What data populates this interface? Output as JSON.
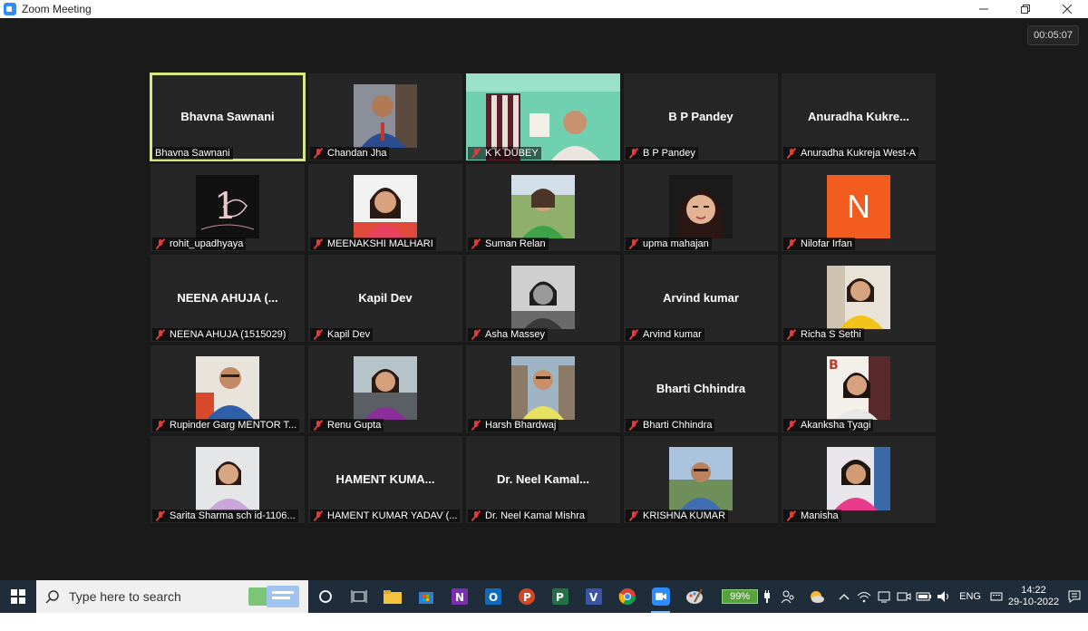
{
  "window": {
    "title": "Zoom Meeting"
  },
  "meeting": {
    "timer": "00:05:07"
  },
  "participants": [
    {
      "name": "Bhavna Sawnani",
      "big_name": "Bhavna Sawnani",
      "muted": false,
      "active": true
    },
    {
      "name": "Chandan Jha",
      "big_name": "",
      "muted": true
    },
    {
      "name": "K K DUBEY",
      "big_name": "",
      "muted": true
    },
    {
      "name": "B P Pandey",
      "big_name": "B P Pandey",
      "muted": true
    },
    {
      "name": "Anuradha Kukreja West-A",
      "big_name": "Anuradha  Kukre...",
      "muted": true
    },
    {
      "name": "rohit_upadhyaya",
      "big_name": "",
      "muted": true
    },
    {
      "name": "MEENAKSHI MALHARI",
      "big_name": "",
      "muted": true
    },
    {
      "name": "Suman Relan",
      "big_name": "",
      "muted": true
    },
    {
      "name": "upma mahajan",
      "big_name": "",
      "muted": true
    },
    {
      "name": "Nilofar Irfan",
      "big_name": "",
      "muted": true,
      "avatar_letter": "N"
    },
    {
      "name": "NEENA AHUJA (1515029)",
      "big_name": "NEENA AHUJA (...",
      "muted": true
    },
    {
      "name": "Kapil Dev",
      "big_name": "Kapil Dev",
      "muted": true
    },
    {
      "name": "Asha Massey",
      "big_name": "",
      "muted": true
    },
    {
      "name": "Arvind kumar",
      "big_name": "Arvind kumar",
      "muted": true
    },
    {
      "name": "Richa S Sethi",
      "big_name": "",
      "muted": true
    },
    {
      "name": "Rupinder Garg MENTOR T...",
      "big_name": "",
      "muted": true
    },
    {
      "name": "Renu Gupta",
      "big_name": "",
      "muted": true
    },
    {
      "name": "Harsh Bhardwaj",
      "big_name": "",
      "muted": true
    },
    {
      "name": "Bharti Chhindra",
      "big_name": "Bharti Chhindra",
      "muted": true
    },
    {
      "name": "Akanksha Tyagi",
      "big_name": "",
      "muted": true
    },
    {
      "name": "Sarita Sharma sch id-1106...",
      "big_name": "",
      "muted": true
    },
    {
      "name": "HAMENT KUMAR YADAV (...",
      "big_name": "HAMENT  KUMA...",
      "muted": true
    },
    {
      "name": "Dr. Neel Kamal Mishra",
      "big_name": "Dr. Neel  Kamal...",
      "muted": true
    },
    {
      "name": "KRISHNA KUMAR",
      "big_name": "",
      "muted": true
    },
    {
      "name": "Manisha",
      "big_name": "",
      "muted": true
    }
  ],
  "taskbar": {
    "search_placeholder": "Type here to search",
    "battery": "99%",
    "language": "ENG",
    "time": "14:22",
    "date": "29-10-2022"
  },
  "colors": {
    "active_outline": "#d9e87a",
    "muted_red": "#e23b3b",
    "taskbar": "#1f2d3a",
    "avatar_orange": "#f25c1f"
  }
}
